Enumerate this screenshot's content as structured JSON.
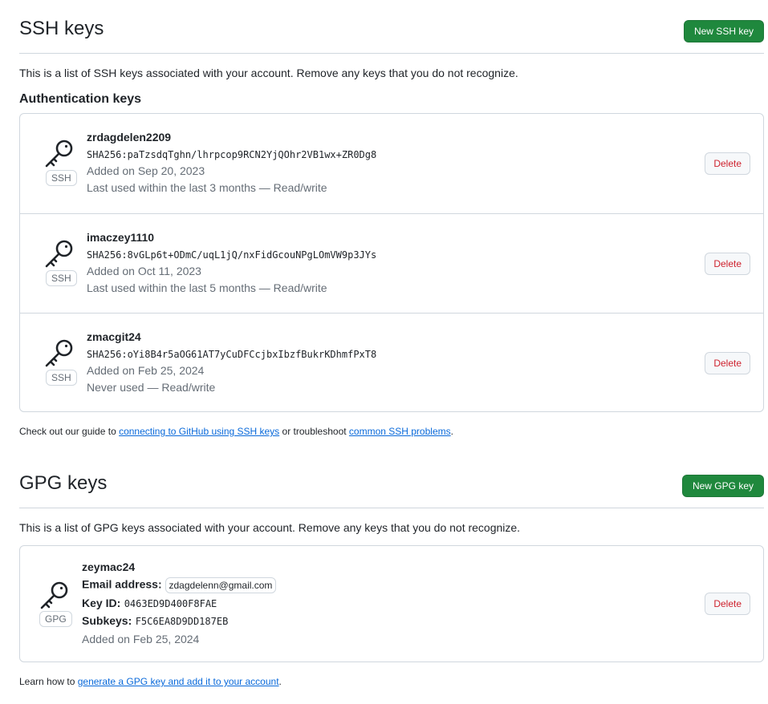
{
  "ssh": {
    "title": "SSH keys",
    "new_button": "New SSH key",
    "description": "This is a list of SSH keys associated with your account. Remove any keys that you do not recognize.",
    "subheading": "Authentication keys",
    "keys": [
      {
        "name": "zrdagdelen2209",
        "fingerprint": "SHA256:paTzsdqTghn/lhrpcop9RCN2YjQOhr2VB1wx+ZR0Dg8",
        "added": "Added on Sep 20, 2023",
        "usage": "Last used within the last 3 months — Read/write",
        "badge": "SSH",
        "delete_label": "Delete"
      },
      {
        "name": "imaczey1110",
        "fingerprint": "SHA256:8vGLp6t+ODmC/uqL1jQ/nxFidGcouNPgLOmVW9p3JYs",
        "added": "Added on Oct 11, 2023",
        "usage": "Last used within the last 5 months — Read/write",
        "badge": "SSH",
        "delete_label": "Delete"
      },
      {
        "name": "zmacgit24",
        "fingerprint": "SHA256:oYi8B4r5aOG61AT7yCuDFCcjbxIbzfBukrKDhmfPxT8",
        "added": "Added on Feb 25, 2024",
        "usage": "Never used — Read/write",
        "badge": "SSH",
        "delete_label": "Delete"
      }
    ],
    "footer": {
      "prefix": "Check out our guide to ",
      "link1": "connecting to GitHub using SSH keys",
      "middle": " or troubleshoot ",
      "link2": "common SSH problems",
      "suffix": "."
    }
  },
  "gpg": {
    "title": "GPG keys",
    "new_button": "New GPG key",
    "description": "This is a list of GPG keys associated with your account. Remove any keys that you do not recognize.",
    "key": {
      "name": "zeymac24",
      "email_label": "Email address:",
      "email": "zdagdelenn@gmail.com",
      "keyid_label": "Key ID:",
      "keyid": "0463ED9D400F8FAE",
      "subkeys_label": "Subkeys:",
      "subkeys": "F5C6EA8D9DD187EB",
      "added": "Added on Feb 25, 2024",
      "badge": "GPG",
      "delete_label": "Delete"
    },
    "footer": {
      "prefix": "Learn how to ",
      "link": "generate a GPG key and add it to your account",
      "suffix": "."
    }
  },
  "colors": {
    "primary_button": "#1f883d",
    "danger_text": "#cf222e",
    "link": "#0969da",
    "border": "#d0d7de",
    "muted_text": "#656d76"
  },
  "icons": {
    "key": "key-icon"
  }
}
